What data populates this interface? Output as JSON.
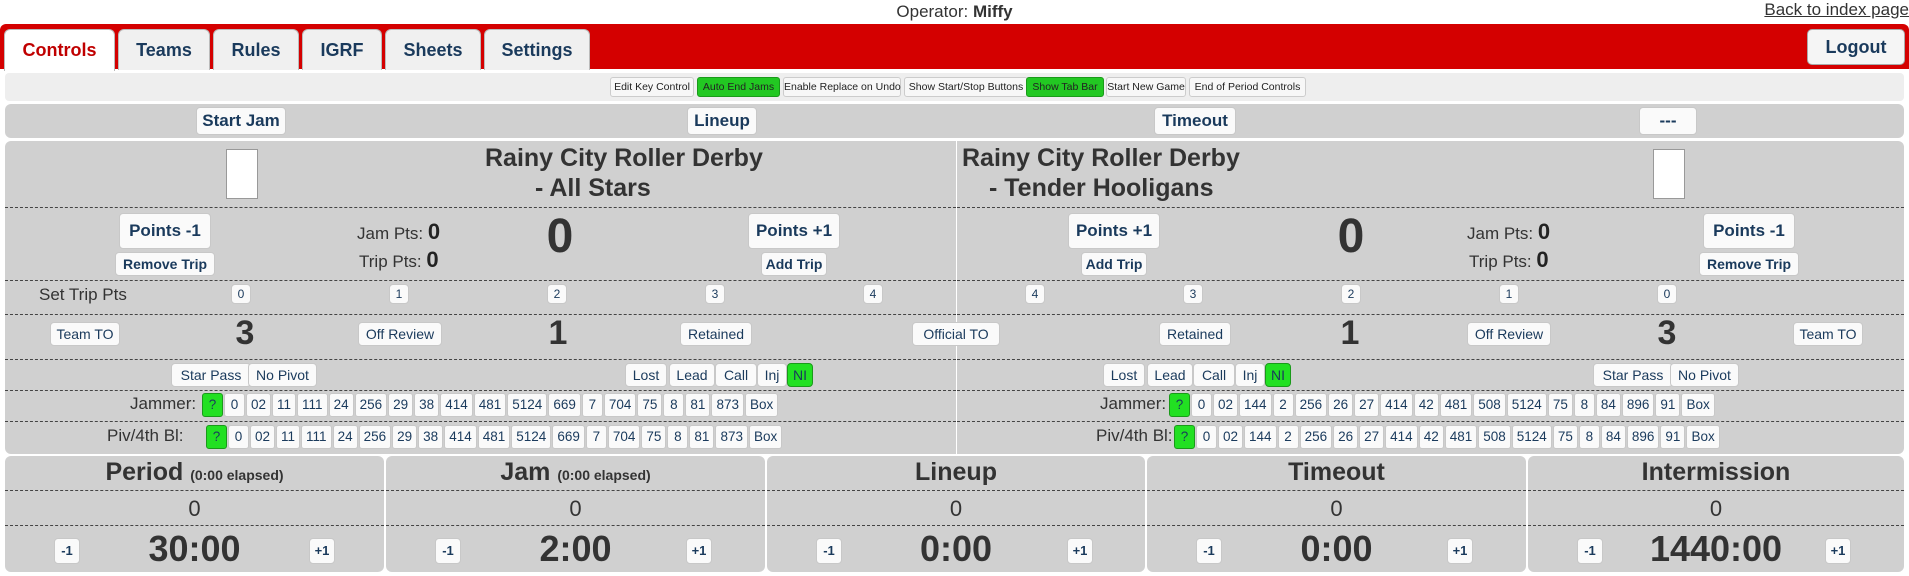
{
  "header": {
    "operator_label": "Operator:",
    "operator_name": "Miffy",
    "back_link": "Back to index page"
  },
  "tabs": [
    {
      "label": "Controls",
      "active": true
    },
    {
      "label": "Teams"
    },
    {
      "label": "Rules"
    },
    {
      "label": "IGRF"
    },
    {
      "label": "Sheets"
    },
    {
      "label": "Settings"
    }
  ],
  "logout_label": "Logout",
  "options": [
    {
      "label": "Edit Key Control",
      "on": false
    },
    {
      "label": "Auto End Jams",
      "on": true
    },
    {
      "label": "Enable Replace on Undo",
      "on": false
    },
    {
      "label": "Show Start/Stop Buttons",
      "on": false
    },
    {
      "label": "Show Tab Bar",
      "on": true
    },
    {
      "label": "Start New Game",
      "on": false
    },
    {
      "label": "End of Period Controls",
      "on": false
    }
  ],
  "jam_controls": {
    "start_jam": "Start Jam",
    "lineup": "Lineup",
    "timeout": "Timeout",
    "undo": "---"
  },
  "teams": {
    "left": {
      "name_line1": "Rainy City Roller Derby",
      "name_line2": "- All Stars",
      "points_minus": "Points -1",
      "points_plus": "Points +1",
      "remove_trip": "Remove Trip",
      "add_trip": "Add Trip",
      "jam_pts_label": "Jam Pts:",
      "jam_pts": "0",
      "trip_pts_label": "Trip Pts:",
      "trip_pts": "0",
      "score": "0",
      "team_to": "Team TO",
      "timeouts": "3",
      "off_review": "Off Review",
      "reviews": "1",
      "retained": "Retained",
      "star_pass": "Star Pass",
      "no_pivot": "No Pivot",
      "lost": "Lost",
      "lead": "Lead",
      "call": "Call",
      "inj": "Inj",
      "ni": "NI",
      "jammer_label": "Jammer:",
      "pivot_label": "Piv/4th Bl:",
      "skaters": [
        "0",
        "02",
        "11",
        "111",
        "24",
        "256",
        "29",
        "38",
        "414",
        "481",
        "5124",
        "669",
        "7",
        "704",
        "75",
        "8",
        "81",
        "873"
      ]
    },
    "right": {
      "name_line1": "Rainy City Roller Derby",
      "name_line2": "- Tender Hooligans",
      "points_minus": "Points -1",
      "points_plus": "Points +1",
      "remove_trip": "Remove Trip",
      "add_trip": "Add Trip",
      "jam_pts_label": "Jam Pts:",
      "jam_pts": "0",
      "trip_pts_label": "Trip Pts:",
      "trip_pts": "0",
      "score": "0",
      "team_to": "Team TO",
      "timeouts": "3",
      "off_review": "Off Review",
      "reviews": "1",
      "retained": "Retained",
      "star_pass": "Star Pass",
      "no_pivot": "No Pivot",
      "lost": "Lost",
      "lead": "Lead",
      "call": "Call",
      "inj": "Inj",
      "ni": "NI",
      "jammer_label": "Jammer:",
      "pivot_label": "Piv/4th Bl:",
      "skaters": [
        "0",
        "02",
        "144",
        "2",
        "256",
        "26",
        "27",
        "414",
        "42",
        "481",
        "508",
        "5124",
        "75",
        "8",
        "84",
        "896",
        "91"
      ]
    }
  },
  "set_trip_pts_label": "Set Trip Pts",
  "trip_values_left": [
    "0",
    "1",
    "2",
    "3",
    "4"
  ],
  "trip_values_right": [
    "4",
    "3",
    "2",
    "1",
    "0"
  ],
  "official_to": "Official TO",
  "unknown_marker": "?",
  "box_label": "Box",
  "clocks": [
    {
      "title": "Period",
      "elapsed": "(0:00 elapsed)",
      "number": "0",
      "time": "30:00"
    },
    {
      "title": "Jam",
      "elapsed": "(0:00 elapsed)",
      "number": "0",
      "time": "2:00"
    },
    {
      "title": "Lineup",
      "elapsed": "",
      "number": "0",
      "time": "0:00"
    },
    {
      "title": "Timeout",
      "elapsed": "",
      "number": "0",
      "time": "0:00"
    },
    {
      "title": "Intermission",
      "elapsed": "",
      "number": "0",
      "time": "1440:00"
    }
  ],
  "clock_minus": "-1",
  "clock_plus": "+1",
  "colors": {
    "tabbar": "#d40000",
    "active_toggle": "#22c822",
    "panel": "#d0d0d0"
  }
}
